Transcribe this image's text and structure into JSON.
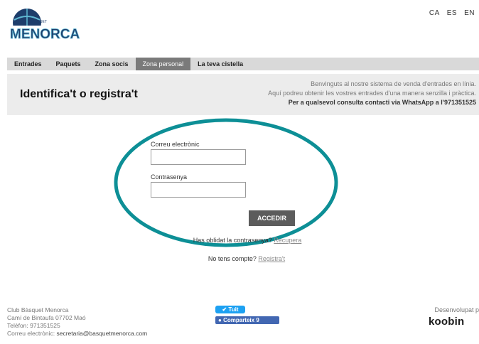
{
  "brand": {
    "top_text": "BÀSQUET",
    "name": "MENORCA",
    "colors": {
      "navy": "#1d3d6b",
      "teal": "#0d8f96"
    }
  },
  "languages": [
    "CA",
    "ES",
    "EN"
  ],
  "nav": {
    "items": [
      {
        "label": "Entrades",
        "active": false
      },
      {
        "label": "Paquets",
        "active": false
      },
      {
        "label": "Zona socis",
        "active": false
      },
      {
        "label": "Zona personal",
        "active": true
      },
      {
        "label": "La teva cistella",
        "active": false
      }
    ]
  },
  "banner": {
    "title": "Identifica't o registra't",
    "line1": "Benvinguts al nostre sistema de venda d'entrades en línia.",
    "line2": "Aquí podreu obtenir les vostres entrades d'una manera senzilla i pràctica.",
    "line3": "Per a qualsevol consulta contacti via WhatsApp a l'971351525"
  },
  "form": {
    "email_label": "Correu electrònic",
    "email_value": "",
    "password_label": "Contrasenya",
    "password_value": "",
    "submit_label": "ACCEDIR",
    "forgot_text": "Has oblidat la contrasenya?",
    "forgot_link": "Recupera",
    "signup_text": "No tens compte?",
    "signup_link": "Registra't"
  },
  "footer": {
    "club": "Club Bàsquet Menorca",
    "address": "Camí de Bintaufa 07702 Maó",
    "phone": "Telèfon: 971351525",
    "email_label": "Correu electrònic:",
    "email": "secretaria@basquetmenorca.com",
    "tuit": "Tuit",
    "share": "Comparteix 9",
    "developed_by": "Desenvolupat p",
    "provider": "koobin"
  }
}
